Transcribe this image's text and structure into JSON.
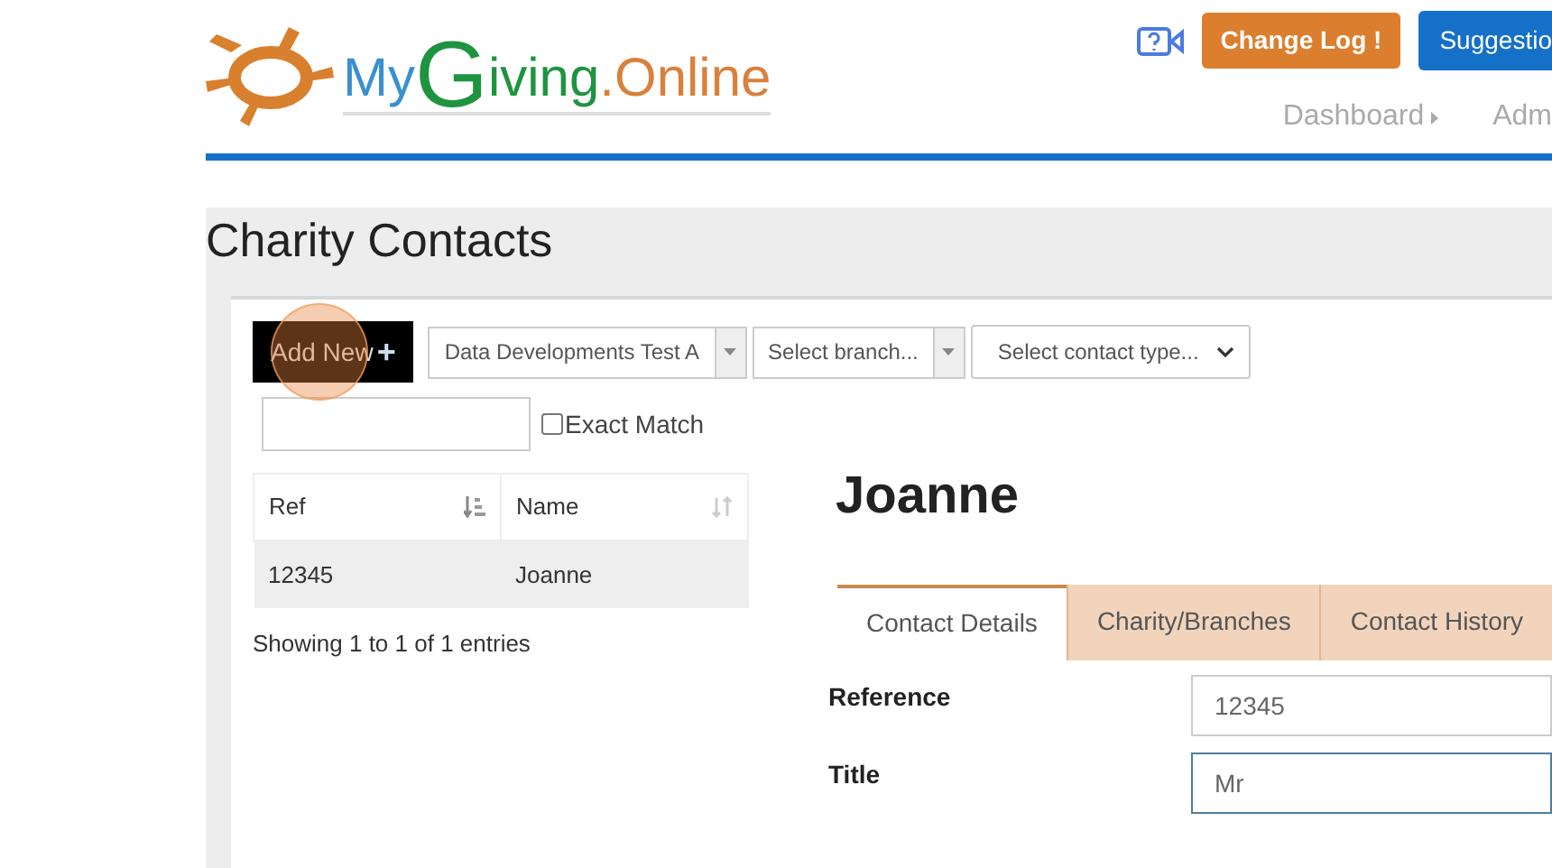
{
  "logo": {
    "parts": [
      "My",
      "G",
      "iving",
      ".Online"
    ]
  },
  "header": {
    "change_log": "Change Log",
    "change_log_mark": "!",
    "suggestions": "Suggestio"
  },
  "nav": [
    {
      "label": "Dashboard",
      "has_submenu": true
    },
    {
      "label": "Adm",
      "has_submenu": false
    }
  ],
  "page_title": "Charity Contacts",
  "toolbar": {
    "add_button": "Add New",
    "add_icon": "+",
    "filters": [
      {
        "kind": "combo",
        "value": "Data Developments Test A"
      },
      {
        "kind": "combo",
        "value": "Select branch..."
      },
      {
        "kind": "select",
        "value": "Select contact type..."
      }
    ]
  },
  "search": {
    "exact_match_label": "Exact Match",
    "exact_match": false
  },
  "table": {
    "columns": [
      {
        "label": "Ref",
        "sorted": true
      },
      {
        "label": "Name",
        "sorted": false
      }
    ],
    "rows": [
      [
        "12345",
        "Joanne"
      ]
    ],
    "info": "Showing 1 to 1 of 1 entries"
  },
  "detail": {
    "name": "Joanne",
    "tabs": [
      {
        "label": "Contact Details",
        "selected": true
      },
      {
        "label": "Charity/Branches",
        "selected": false
      },
      {
        "label": "Contact History",
        "selected": false
      }
    ],
    "fields": [
      {
        "label": "Reference",
        "value": "12345",
        "focused": false
      },
      {
        "label": "Title",
        "value": "Mr",
        "focused": true
      }
    ]
  }
}
